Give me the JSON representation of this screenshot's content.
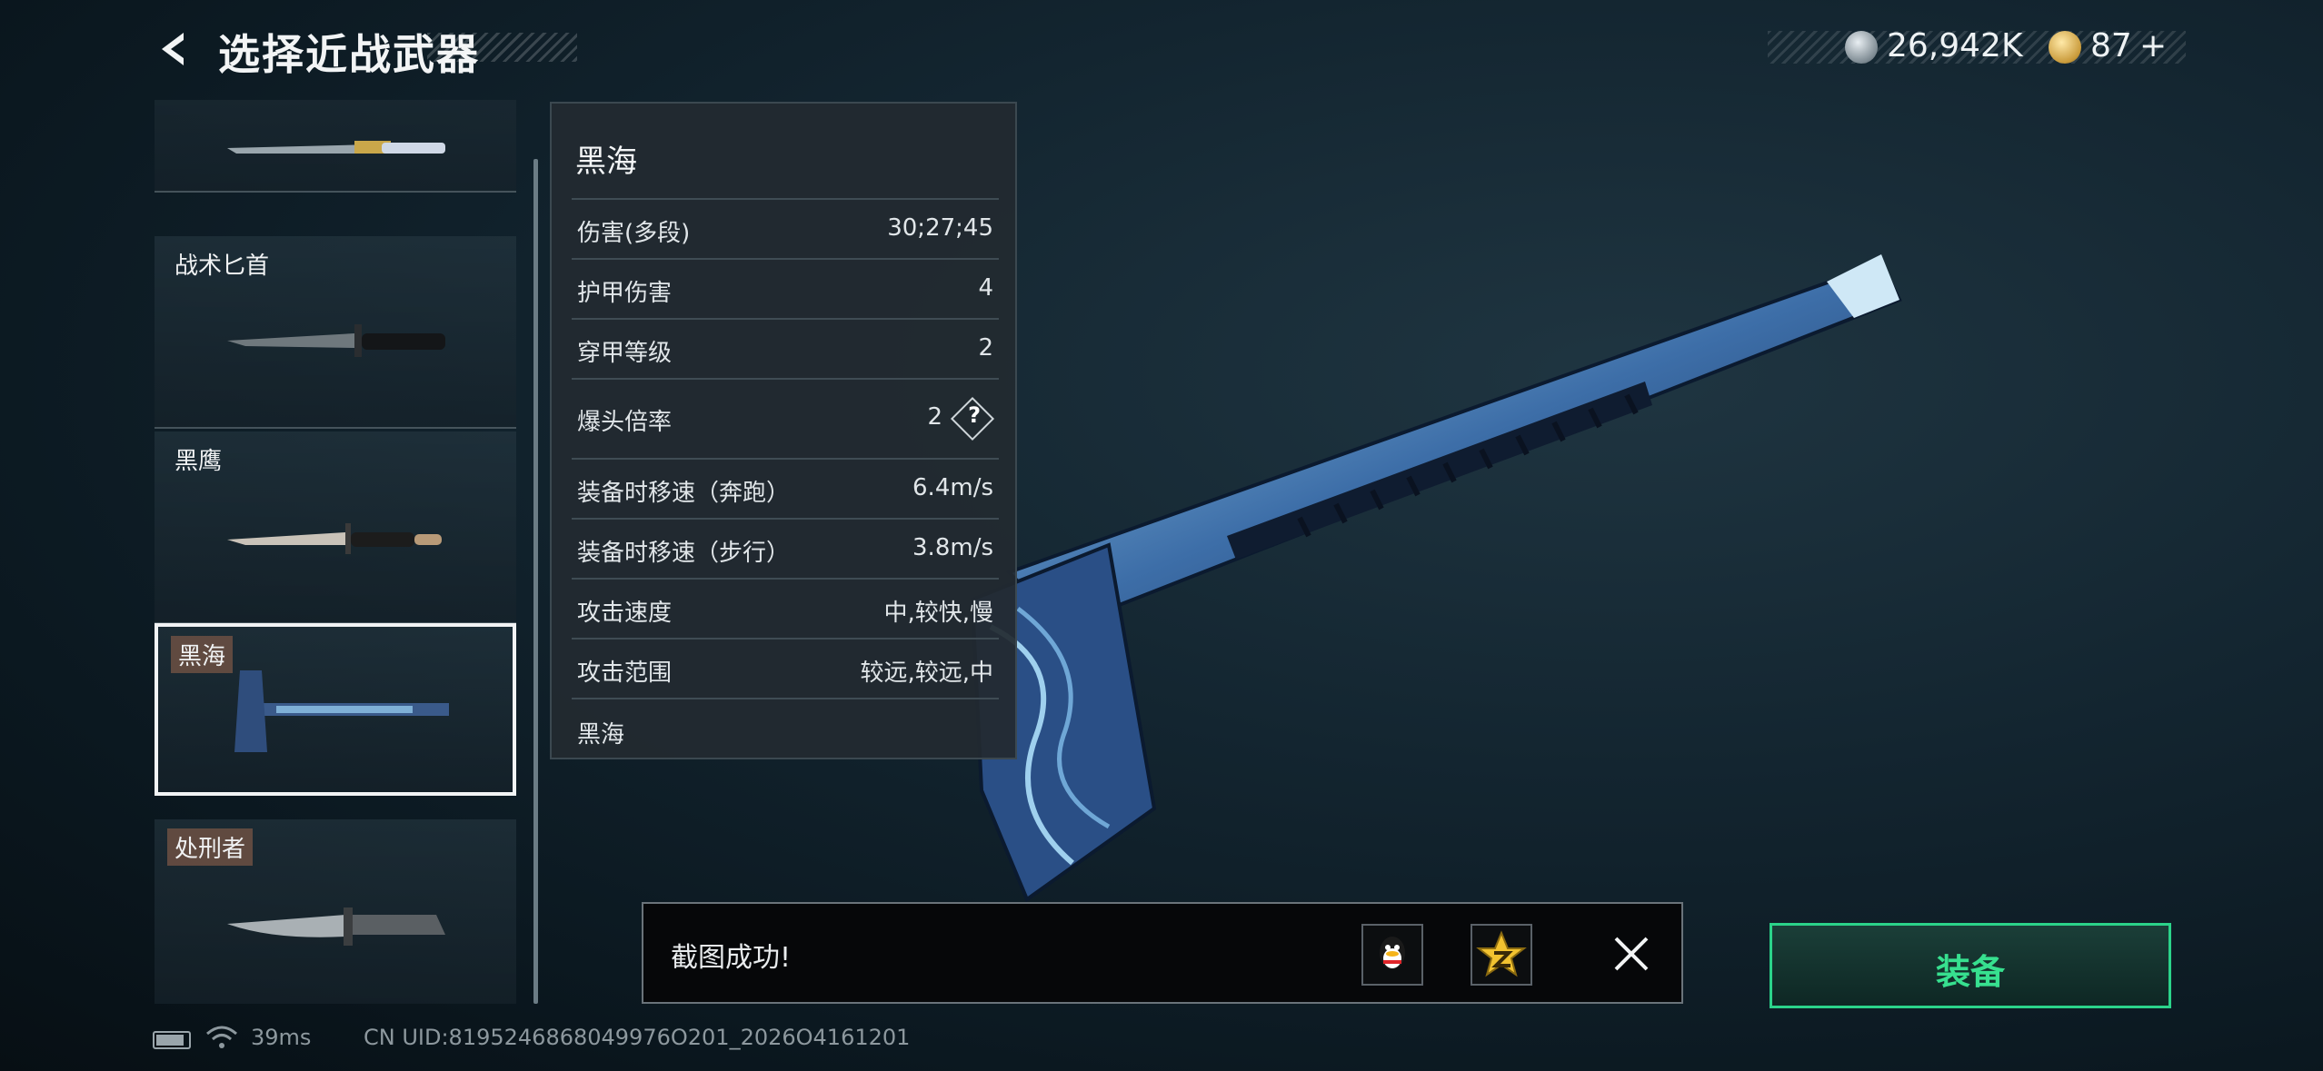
{
  "header": {
    "title": "选择近战武器"
  },
  "currency": {
    "silver": "26,942K",
    "gold": "87",
    "gold_add": "+"
  },
  "weapon_list": {
    "items": [
      {
        "label": ""
      },
      {
        "label": "战术匕首"
      },
      {
        "label": "黑鹰"
      },
      {
        "label": "黑海",
        "selected": true
      },
      {
        "label": "处刑者"
      }
    ]
  },
  "stats": {
    "name": "黑海",
    "rows": [
      {
        "label": "伤害(多段)",
        "value": "30;27;45"
      },
      {
        "label": "护甲伤害",
        "value": "4"
      },
      {
        "label": "穿甲等级",
        "value": "2"
      },
      {
        "label": "爆头倍率",
        "value": "2",
        "help": "?"
      },
      {
        "label": "装备时移速（奔跑）",
        "value": "6.4m/s"
      },
      {
        "label": "装备时移速（步行）",
        "value": "3.8m/s"
      },
      {
        "label": "攻击速度",
        "value": "中,较快,慢"
      },
      {
        "label": "攻击范围",
        "value": "较远,较远,中"
      }
    ],
    "footer": "黑海"
  },
  "toast": {
    "text": "截图成功!"
  },
  "equip": {
    "label": "装备"
  },
  "footer": {
    "ping": "39ms",
    "uid": "CN UID:8195246868049976O201_2026O4161201"
  },
  "icons": [
    "back-arrow-icon",
    "silver-coin-icon",
    "gold-coin-icon",
    "qq-share-icon",
    "qzone-share-icon",
    "close-icon",
    "battery-icon",
    "wifi-icon"
  ],
  "colors": {
    "accent": "#37e08f",
    "panel": "#222a30",
    "background": "#0f2029"
  }
}
